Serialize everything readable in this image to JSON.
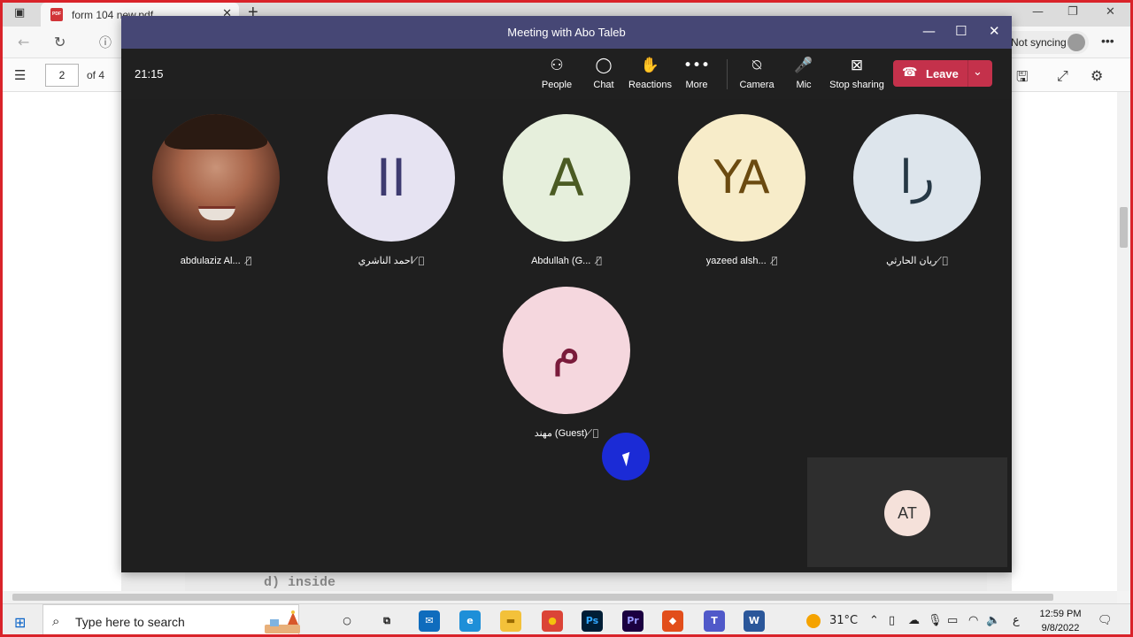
{
  "browser": {
    "tab_title": "form 104 new.pdf",
    "pdf_badge": "PDF",
    "sync_label": "Not syncing",
    "page_number": "2",
    "page_count_label": "of 4",
    "pdf_visible_text": "d) inside"
  },
  "meeting": {
    "window_title": "Meeting with Abo Taleb",
    "timer": "21:15",
    "toolbar": [
      {
        "label": "People",
        "icon": "people-icon"
      },
      {
        "label": "Chat",
        "icon": "chat-icon"
      },
      {
        "label": "Reactions",
        "icon": "reactions-icon"
      },
      {
        "label": "More",
        "icon": "more-icon"
      },
      {
        "label": "Camera",
        "icon": "camera-off-icon"
      },
      {
        "label": "Mic",
        "icon": "mic-icon"
      },
      {
        "label": "Stop sharing",
        "icon": "stop-sharing-icon"
      }
    ],
    "leave_label": "Leave",
    "participants": [
      {
        "name": "abdulaziz Al...",
        "initials": "",
        "avatar_type": "photo",
        "bg": "#6b3b2a",
        "fg": "#ffffff",
        "muted": true
      },
      {
        "name": "احمد الناشري",
        "initials": "II",
        "avatar_type": "initials",
        "bg": "#e6e3f2",
        "fg": "#3d3a70",
        "muted": true
      },
      {
        "name": "Abdullah (G...",
        "initials": "A",
        "avatar_type": "initials",
        "bg": "#e6efdc",
        "fg": "#4b5b23",
        "muted": true
      },
      {
        "name": "yazeed alsh...",
        "initials": "YA",
        "avatar_type": "initials",
        "bg": "#f7ecc9",
        "fg": "#6b4a10",
        "muted": true
      },
      {
        "name": "ريان الحارثي",
        "initials": "را",
        "avatar_type": "initials",
        "bg": "#dde5ec",
        "fg": "#263845",
        "muted": true
      },
      {
        "name": "مهند (Guest)",
        "initials": "م",
        "avatar_type": "initials",
        "bg": "#f5d7de",
        "fg": "#7a1b3b",
        "muted": true
      }
    ],
    "self_initials": "AT"
  },
  "taskbar": {
    "search_placeholder": "Type here to search",
    "weather": "31°C",
    "language": "ع",
    "time": "12:59 PM",
    "date": "9/8/2022",
    "apps": [
      {
        "name": "cortana",
        "glyph": "○",
        "bg": "transparent",
        "fg": "#111111"
      },
      {
        "name": "task-view",
        "glyph": "⧉",
        "bg": "transparent",
        "fg": "#111111"
      },
      {
        "name": "mail",
        "glyph": "✉",
        "bg": "#0f6cbd",
        "fg": "#ffffff"
      },
      {
        "name": "edge",
        "glyph": "e",
        "bg": "#1e8fd8",
        "fg": "#ffffff"
      },
      {
        "name": "file-explorer",
        "glyph": "▬",
        "bg": "#f3c13a",
        "fg": "#9a6b00"
      },
      {
        "name": "chrome",
        "glyph": "●",
        "bg": "#db4437",
        "fg": "#f4c20d"
      },
      {
        "name": "photoshop",
        "glyph": "Ps",
        "bg": "#001e36",
        "fg": "#31a8ff"
      },
      {
        "name": "premiere",
        "glyph": "Pr",
        "bg": "#1b0040",
        "fg": "#9999ff"
      },
      {
        "name": "office",
        "glyph": "◆",
        "bg": "#e24e1b",
        "fg": "#ffffff"
      },
      {
        "name": "teams",
        "glyph": "T",
        "bg": "#5059c9",
        "fg": "#ffffff"
      },
      {
        "name": "word",
        "glyph": "W",
        "bg": "#2b579a",
        "fg": "#ffffff"
      }
    ]
  },
  "colors": {
    "teams_titlebar": "#464775",
    "leave_button": "#c4314b",
    "stage_bg": "#1f1f1f",
    "cursor_highlight": "#1b2bd6",
    "record_border": "#d9232a"
  }
}
